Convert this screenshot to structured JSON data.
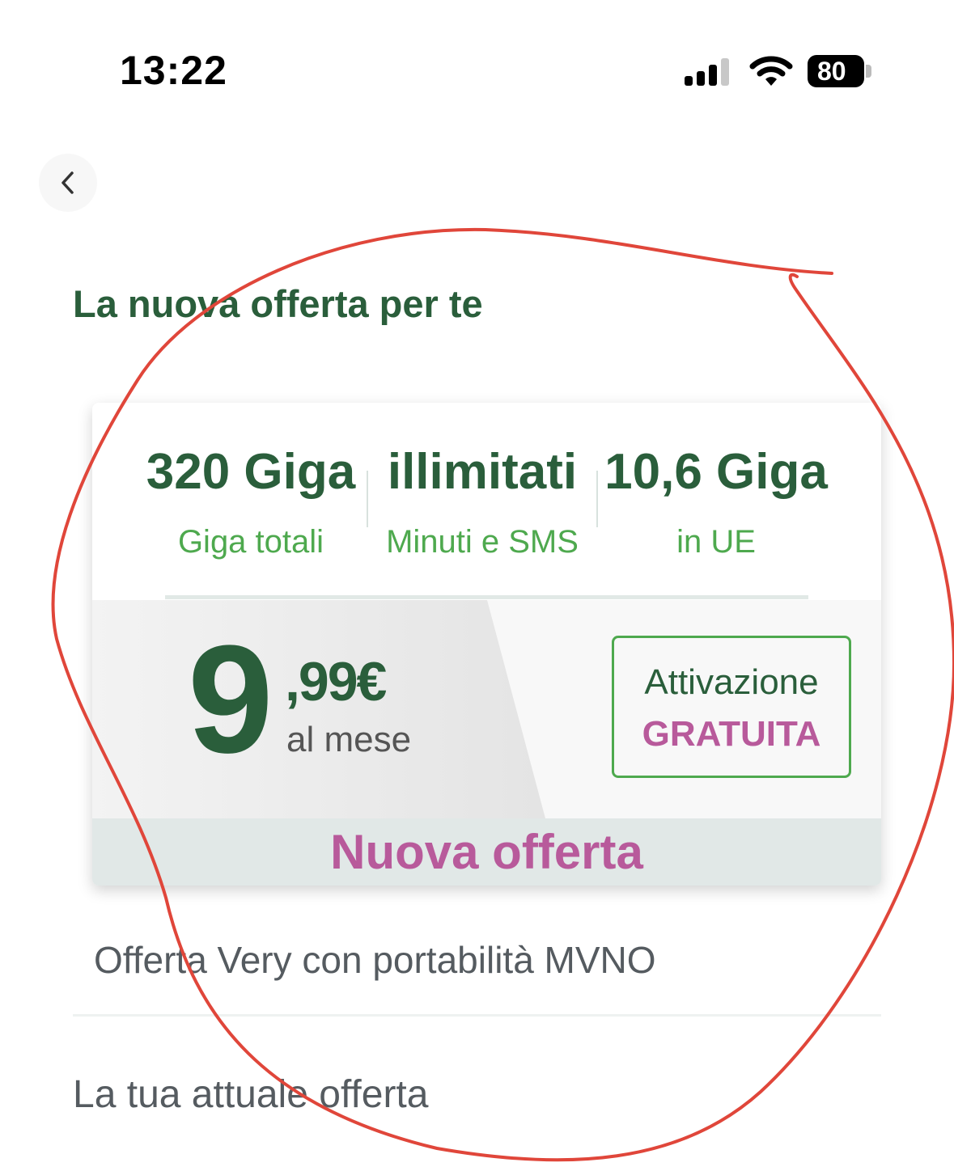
{
  "status_bar": {
    "time": "13:22",
    "battery": "80"
  },
  "page": {
    "title": "La nuova offerta per te"
  },
  "offer_card": {
    "features": [
      {
        "value": "320 Giga",
        "label": "Giga totali"
      },
      {
        "value": "illimitati",
        "label": "Minuti e SMS"
      },
      {
        "value": "10,6 Giga",
        "label": "in UE"
      }
    ],
    "price": {
      "integer": "9",
      "decimal": ",99€",
      "unit": "al mese"
    },
    "activation": {
      "line1": "Attivazione",
      "line2": "GRATUITA"
    },
    "badge": "Nuova offerta"
  },
  "offer_subtitle": "Offerta Very con portabilità MVNO",
  "current_offer_label": "La tua attuale offerta",
  "colors": {
    "brand_green": "#2a5e3b",
    "accent_green": "#4ea94e",
    "accent_pink": "#b85a9b",
    "annotation_red": "#e0463a"
  },
  "icons": {
    "back": "chevron-left-icon",
    "signal": "cellular-signal-icon",
    "wifi": "wifi-icon",
    "battery": "battery-icon"
  }
}
